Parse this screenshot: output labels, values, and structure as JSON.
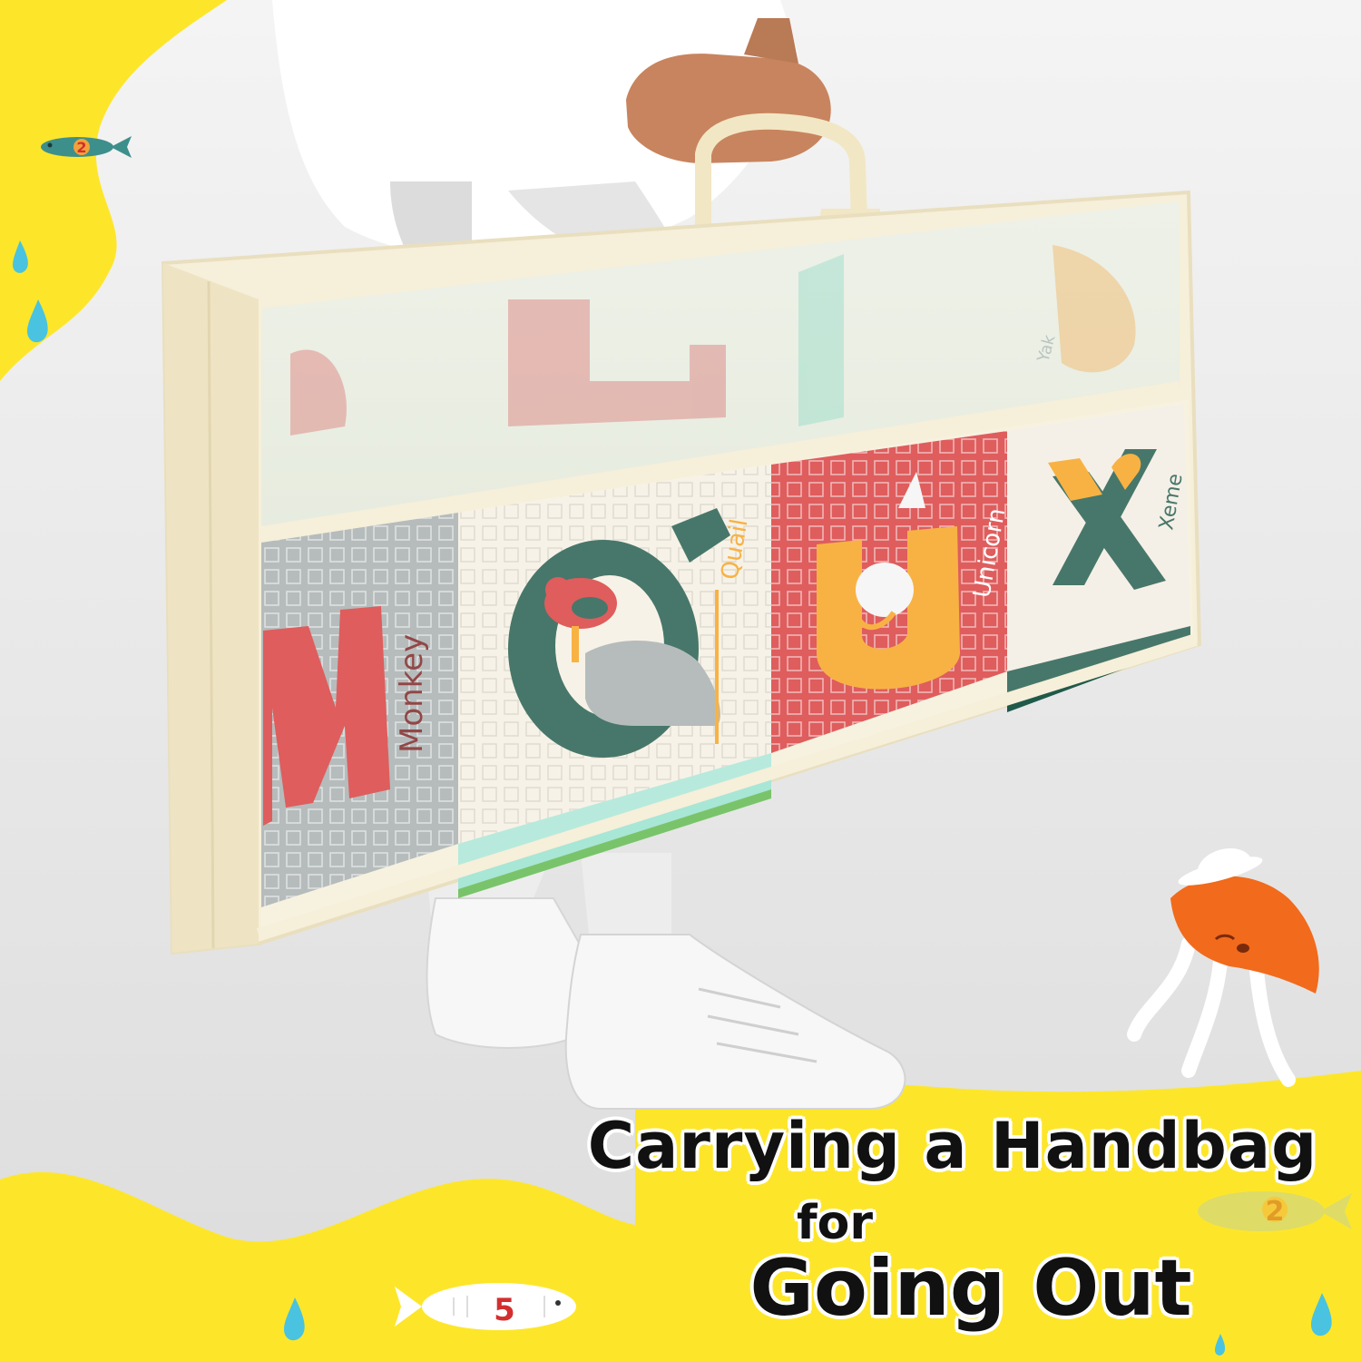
{
  "headline": {
    "line1": "Carrying a Handbag",
    "line2": "for",
    "line3": "Going Out"
  },
  "tiles": {
    "top_faded": "Yak",
    "monkey": "Monkey",
    "quail": "Quail",
    "unicorn": "Unicorn",
    "xeme": "Xeme"
  },
  "fish_numbers": {
    "top_left": "2",
    "right": "2",
    "bottom": "5"
  },
  "colors": {
    "yellow": "#fde62a",
    "cream": "#f6efd9",
    "red": "#d83a3a",
    "green": "#1f5a4a",
    "orange": "#f7a21b",
    "grey": "#a7aeae",
    "mint": "#a8e6d6",
    "jelly": "#f26a1b"
  }
}
